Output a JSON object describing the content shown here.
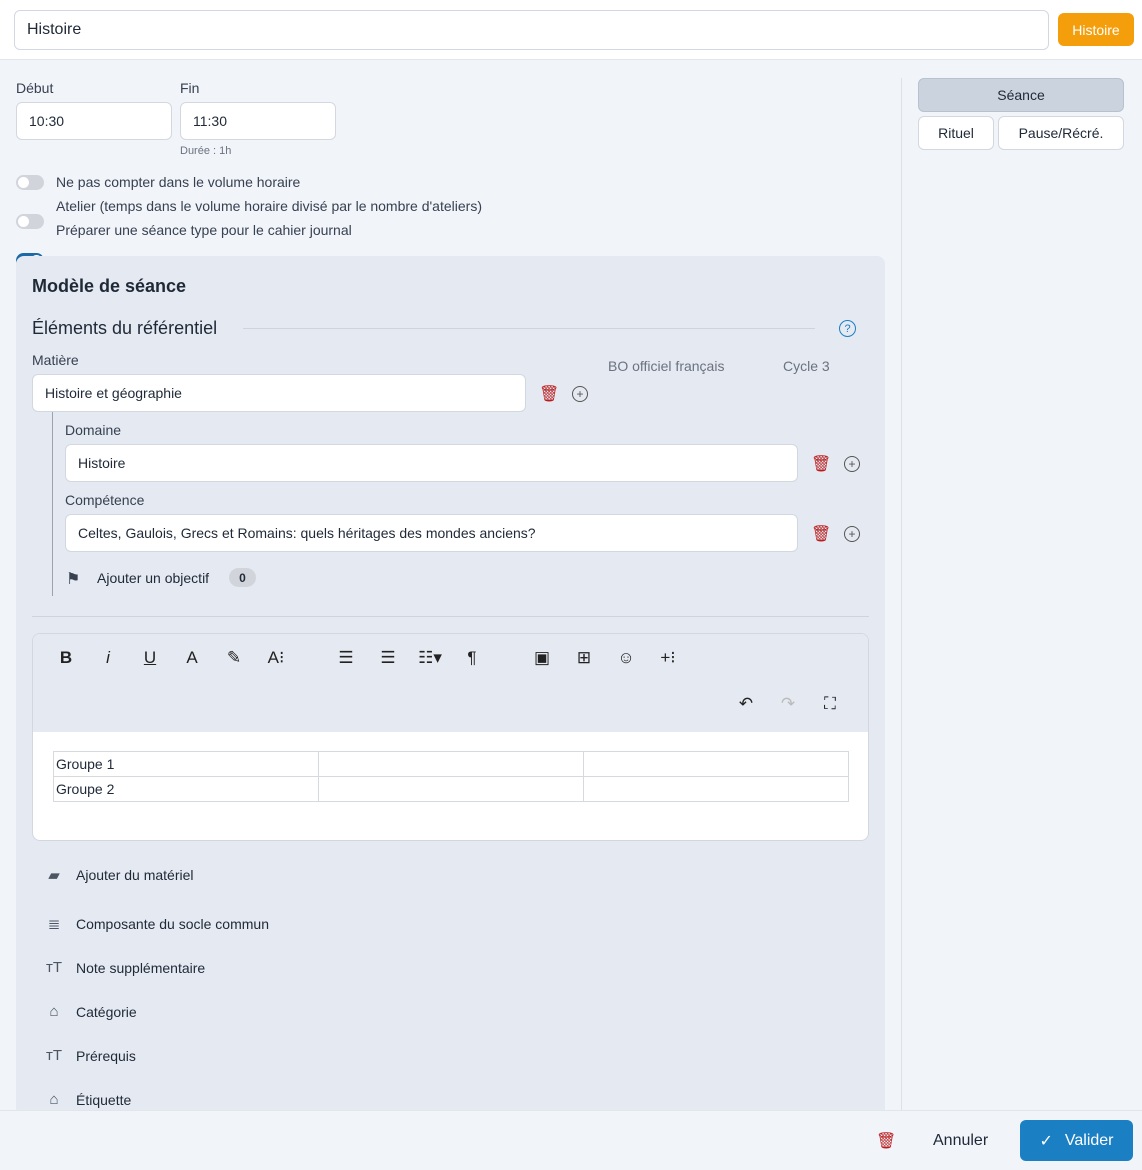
{
  "header": {
    "title_value": "Histoire",
    "subject_badge": "Histoire",
    "badge_color": "#f59e0b"
  },
  "time": {
    "start_label": "Début",
    "start_value": "10:30",
    "end_label": "Fin",
    "end_value": "11:30",
    "duration": "Durée : 1h"
  },
  "toggles": [
    {
      "label": "Ne pas compter dans le volume horaire",
      "on": false
    },
    {
      "label": "Atelier (temps dans le volume horaire divisé par le nombre d'ateliers)",
      "on": false
    },
    {
      "label": "Préparer une séance type pour le cahier journal",
      "on": true
    }
  ],
  "types": {
    "seance": "Séance",
    "rituel": "Rituel",
    "pause": "Pause/Récré."
  },
  "model": {
    "title": "Modèle de séance",
    "ref_title": "Éléments du référentiel",
    "bo": "BO officiel français",
    "cycle": "Cycle 3",
    "matiere_label": "Matière",
    "matiere_value": "Histoire et géographie",
    "domaine_label": "Domaine",
    "domaine_value": "Histoire",
    "competence_label": "Compétence",
    "competence_value": "Celtes, Gaulois, Grecs et Romains: quels héritages des mondes anciens?",
    "objectif_label": "Ajouter un objectif",
    "objectif_count": "0"
  },
  "editor": {
    "table": [
      [
        "Groupe 1",
        "",
        ""
      ],
      [
        "Groupe 2",
        "",
        ""
      ]
    ]
  },
  "sections": [
    {
      "icon": "briefcase-icon",
      "label": "Ajouter du matériel"
    },
    {
      "icon": "list-icon",
      "label": "Composante du socle commun"
    },
    {
      "icon": "text-size-icon",
      "label": "Note supplémentaire"
    },
    {
      "icon": "tag-icon",
      "label": "Catégorie"
    },
    {
      "icon": "text-size-icon",
      "label": "Prérequis"
    },
    {
      "icon": "tag-icon",
      "label": "Étiquette"
    }
  ],
  "footer": {
    "cancel": "Annuler",
    "validate": "Valider",
    "accent": "#1b7fc4"
  }
}
